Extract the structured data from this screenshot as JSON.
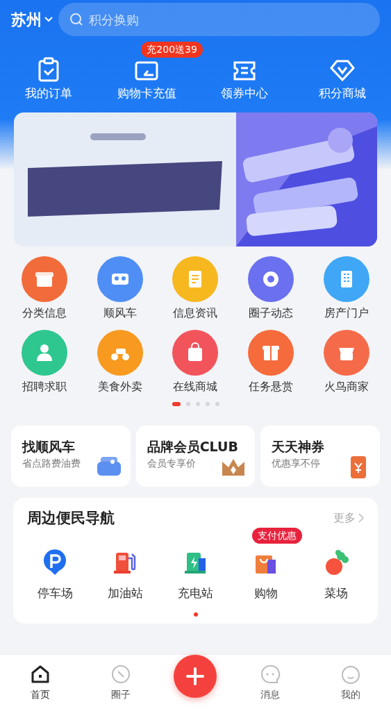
{
  "header": {
    "city": "苏州",
    "search": {
      "placeholder": "积分换购"
    }
  },
  "quick_actions": [
    {
      "label": "我的订单"
    },
    {
      "label": "购物卡充值",
      "badge": "充200送39"
    },
    {
      "label": "领券中心"
    },
    {
      "label": "积分商城"
    }
  ],
  "services": [
    {
      "label": "分类信息",
      "color": "#f26b3a"
    },
    {
      "label": "顺风车",
      "color": "#4f8ff5"
    },
    {
      "label": "信息资讯",
      "color": "#f7b81f"
    },
    {
      "label": "圈子动态",
      "color": "#6a70f0"
    },
    {
      "label": "房产门户",
      "color": "#3fa7f5"
    },
    {
      "label": "招聘求职",
      "color": "#2ec78f"
    },
    {
      "label": "美食外卖",
      "color": "#f79a1f"
    },
    {
      "label": "在线商城",
      "color": "#f2545b"
    },
    {
      "label": "任务悬赏",
      "color": "#f56b3c"
    },
    {
      "label": "火鸟商家",
      "color": "#f56b4a"
    }
  ],
  "pager": [
    {
      "selected": true
    },
    {
      "selected": false
    },
    {
      "selected": false
    },
    {
      "selected": false
    },
    {
      "selected": false
    }
  ],
  "promos": [
    {
      "title": "找顺风车",
      "subtitle": "省点路费油费",
      "color": "#5b8ff0"
    },
    {
      "title": "品牌会员CLUB",
      "subtitle": "会员专享价",
      "color": "#c8864f"
    },
    {
      "title": "天天神券",
      "subtitle": "优惠享不停",
      "color": "#ec6f3a"
    }
  ],
  "nearby": {
    "title": "周边便民导航",
    "more": "更多",
    "items": [
      {
        "label": "停车场"
      },
      {
        "label": "加油站"
      },
      {
        "label": "充电站"
      },
      {
        "label": "购物",
        "badge": "支付优惠"
      },
      {
        "label": "菜场"
      }
    ],
    "pager": [
      {
        "selected": true
      }
    ]
  },
  "tab_bar": [
    {
      "label": "首页",
      "selected": true
    },
    {
      "label": "圈子",
      "selected": false
    },
    {
      "kind": "add"
    },
    {
      "label": "消息",
      "selected": false
    },
    {
      "label": "我的",
      "selected": false
    }
  ]
}
